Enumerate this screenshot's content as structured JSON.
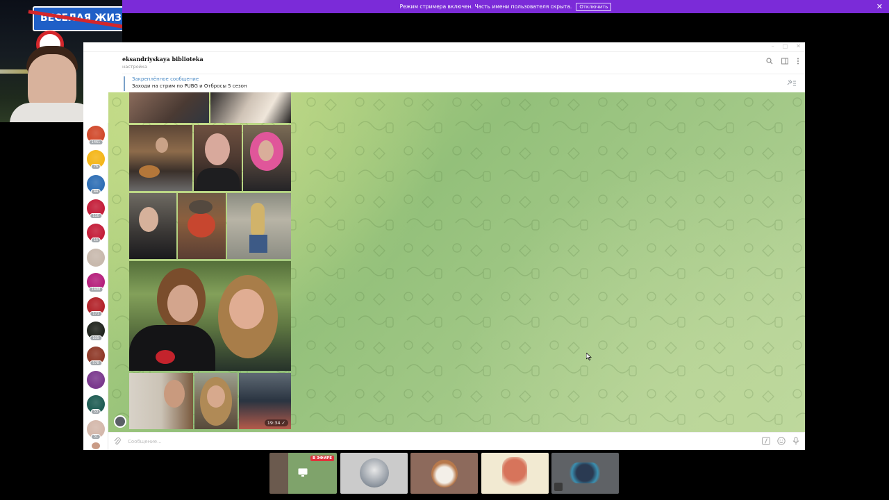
{
  "banner": {
    "text": "Режим стримера включен. Часть имени пользователя скрыта.",
    "button_label": "Отключить",
    "close_glyph": "✕",
    "color": "#7b2bd8"
  },
  "webcam": {
    "sign_text": "ВЕСЕЛАЯ ЖИЗ"
  },
  "window": {
    "controls": [
      "–",
      "□",
      "✕"
    ]
  },
  "chat": {
    "title": "eksandriyskaya biblioteka",
    "subtitle": "настройка",
    "header_icons": [
      "search-icon",
      "sidebar-toggle-icon",
      "more-vert-icon"
    ]
  },
  "pinned": {
    "title": "Закреплённое сообщение",
    "text": "Заходи на стрим по PUBG и Отбросы 5 сезон"
  },
  "sidebar": {
    "items": [
      {
        "badge": "1461",
        "color": "#d14a2c"
      },
      {
        "badge": "76",
        "color": "#f4b619"
      },
      {
        "badge": "44",
        "color": "#2f6fb5"
      },
      {
        "badge": "110",
        "color": "#c41f3a"
      },
      {
        "badge": "15",
        "color": "#c41f3a"
      },
      {
        "badge": "",
        "color": "#c8b9ad"
      },
      {
        "badge": "1408",
        "color": "#b6217d"
      },
      {
        "badge": "171",
        "color": "#b3242b"
      },
      {
        "badge": "105",
        "color": "#22261f"
      },
      {
        "badge": "578",
        "color": "#8f3a29"
      },
      {
        "badge": "",
        "color": "#7b3a8e"
      },
      {
        "badge": "53",
        "color": "#1f5d54"
      },
      {
        "badge": "31",
        "color": "#d4b8ab"
      }
    ]
  },
  "message": {
    "time": "19:34",
    "read_glyph": "✓"
  },
  "input": {
    "placeholder": "Сообщение..."
  },
  "tiles": {
    "live_label": "В ЭФИРЕ",
    "items": [
      {
        "kind": "screen-share",
        "color": "#6a9a5f"
      },
      {
        "kind": "avatar",
        "color": "#c9c9c9"
      },
      {
        "kind": "avatar",
        "color": "#8a6458"
      },
      {
        "kind": "avatar",
        "color": "#efe6c8"
      },
      {
        "kind": "avatar",
        "color": "#5f6266"
      }
    ]
  },
  "colors": {
    "accent": "#4c8bc5",
    "chat_green": "#a9cc8d"
  }
}
